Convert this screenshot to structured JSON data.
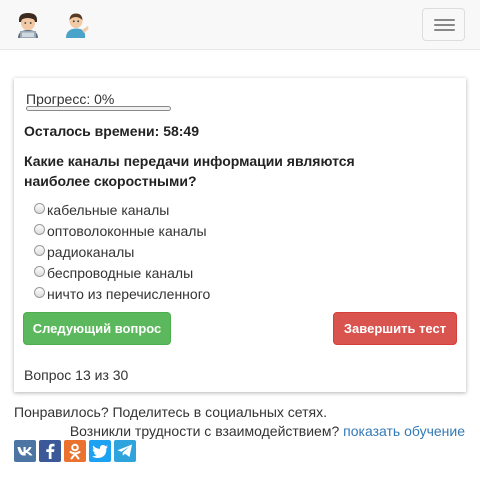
{
  "navbar": {
    "avatars": [
      "man-technologist-icon",
      "man-tipping-hand-icon"
    ],
    "menu_icon": "hamburger-icon"
  },
  "quiz": {
    "progress_label": "Прогресс: 0%",
    "progress_fraction": 0,
    "timer": "Осталось времени: 58:49",
    "question": "Какие каналы передачи информации являются наиболее скоростными?",
    "options": [
      "кабельные каналы",
      "оптоволоконные каналы",
      "радиоканалы",
      "беспроводные каналы",
      "ничто из перечисленного"
    ],
    "next_button": "Следующий вопрос",
    "finish_button": "Завершить тест",
    "counter": "Вопрос 13 из 30"
  },
  "footer": {
    "share_text": "Понравилось? Поделитесь в социальных сетях.",
    "help_text": "Возникли трудности с взаимодействием?",
    "help_link": "показать обучение",
    "socials": [
      {
        "name": "vk-icon",
        "color": "#4c75a3"
      },
      {
        "name": "facebook-icon",
        "color": "#3b5998"
      },
      {
        "name": "odnoklassniki-icon",
        "color": "#eb722e"
      },
      {
        "name": "twitter-icon",
        "color": "#1da1f2"
      },
      {
        "name": "telegram-icon",
        "color": "#2fa4dc"
      }
    ]
  },
  "colors": {
    "success": "#5cb85c",
    "danger": "#d9534f",
    "link": "#337ab7"
  }
}
